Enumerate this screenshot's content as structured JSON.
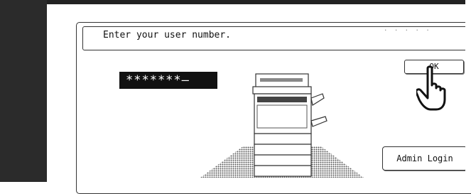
{
  "prompt": {
    "text": "Enter your user number."
  },
  "password": {
    "masked_value": "*******",
    "cursor": "—"
  },
  "buttons": {
    "ok_label": "OK",
    "admin_login_label": "Admin Login"
  },
  "icons": {
    "copier": "copier-machine-icon",
    "pointer": "pointing-hand-icon"
  }
}
